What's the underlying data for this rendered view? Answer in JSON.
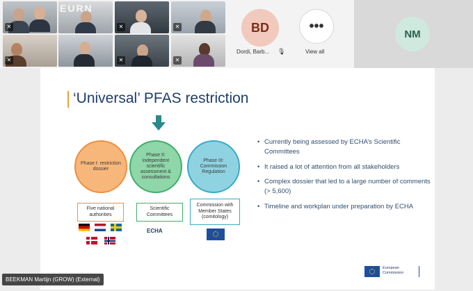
{
  "participants": {
    "tiles": [
      {
        "id": "p1",
        "muted": true
      },
      {
        "id": "p2",
        "muted": false
      },
      {
        "id": "p3",
        "muted": false,
        "overlay_text": "EURN"
      },
      {
        "id": "p4",
        "muted": true
      },
      {
        "id": "p5",
        "muted": true
      },
      {
        "id": "p6",
        "muted": true
      },
      {
        "id": "p7",
        "muted": false
      },
      {
        "id": "p8",
        "muted": false,
        "active_speaker": true
      },
      {
        "id": "p9",
        "muted": true
      },
      {
        "id": "p10",
        "muted": true
      }
    ],
    "bd": {
      "initials": "BD",
      "name": "Dordi, Barb..."
    },
    "view_all": {
      "glyph": "•••",
      "label": "View all"
    },
    "nm": {
      "initials": "NM"
    }
  },
  "slide": {
    "title": "‘Universal’ PFAS restriction",
    "phases": [
      {
        "label": "Phase I: restriction dossier",
        "color": "#f8b77a"
      },
      {
        "label": "Phase II: independent scientific assessment & consultations",
        "color": "#8fd6a8"
      },
      {
        "label": "Phase III: Commission Regulation",
        "color": "#8fd3e2"
      }
    ],
    "actors": [
      {
        "label": "Five national authorities"
      },
      {
        "label": "Scientific Committees"
      },
      {
        "label": "Commission with Member States (comitology)"
      }
    ],
    "echa_logo_text": "ECHA",
    "bullets": [
      "Currently being assessed by ECHA’s Scientific Committees",
      "It raised a lot of attention from all stakeholders",
      "Complex dossier that led to a large number of comments (> 5,600)",
      "Timeline and workplan under preparation by ECHA"
    ],
    "ec_logo_text": {
      "line1": "European",
      "line2": "Commission"
    }
  },
  "speaker": {
    "name": "BEEKMAN Martijn (GROW) (External)"
  },
  "colors": {
    "accent": "#5b5fc7",
    "title": "#1f3d6b",
    "arrow": "#2a8a8a"
  }
}
